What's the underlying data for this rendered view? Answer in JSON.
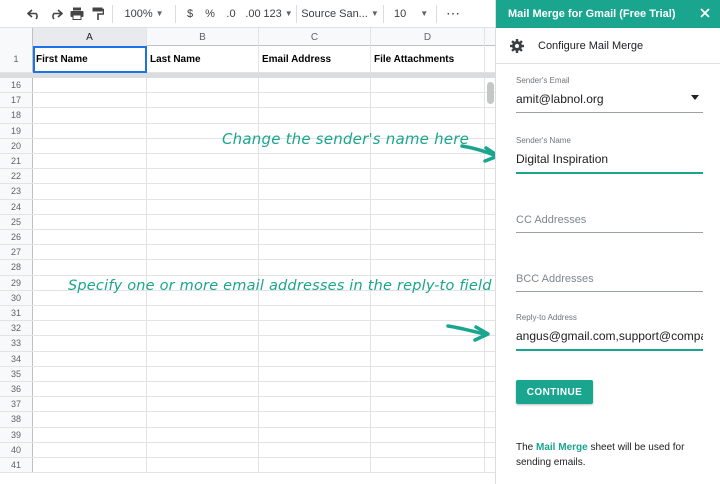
{
  "toolbar": {
    "zoom": "100%",
    "currency": "$",
    "percent": "%",
    "decimal_decrease": ".0",
    "decimal_increase": ".00",
    "number_format": "123",
    "font": "Source San...",
    "font_size": "10",
    "more": "⋯"
  },
  "sheet": {
    "columns": [
      "A",
      "B",
      "C",
      "D"
    ],
    "header_row_number": "1",
    "headers": [
      "First Name",
      "Last Name",
      "Email Address",
      "File Attachments"
    ],
    "row_numbers": [
      "16",
      "17",
      "18",
      "19",
      "20",
      "21",
      "22",
      "23",
      "24",
      "25",
      "26",
      "27",
      "28",
      "29",
      "30",
      "31",
      "32",
      "33",
      "34",
      "35",
      "36",
      "37",
      "38",
      "39",
      "40",
      "41"
    ]
  },
  "annotations": {
    "sender_note": "Change the sender's name here",
    "replyto_note": "Specify one or more email addresses in the reply-to field"
  },
  "sidebar": {
    "title": "Mail Merge for Gmail (Free Trial)",
    "header": "Configure Mail Merge",
    "senders_email": {
      "label": "Sender's Email",
      "value": "amit@labnol.org"
    },
    "senders_name": {
      "label": "Sender's Name",
      "value": "Digital Inspiration"
    },
    "cc": {
      "placeholder": "CC Addresses"
    },
    "bcc": {
      "placeholder": "BCC Addresses"
    },
    "reply_to": {
      "label": "Reply-to Address",
      "value": "angus@gmail.com,support@company.com"
    },
    "continue_label": "CONTINUE",
    "footer": {
      "pre": "The ",
      "highlight": "Mail Merge",
      "post": " sheet will be used for sending emails."
    },
    "accent_color": "#1aa58e"
  }
}
